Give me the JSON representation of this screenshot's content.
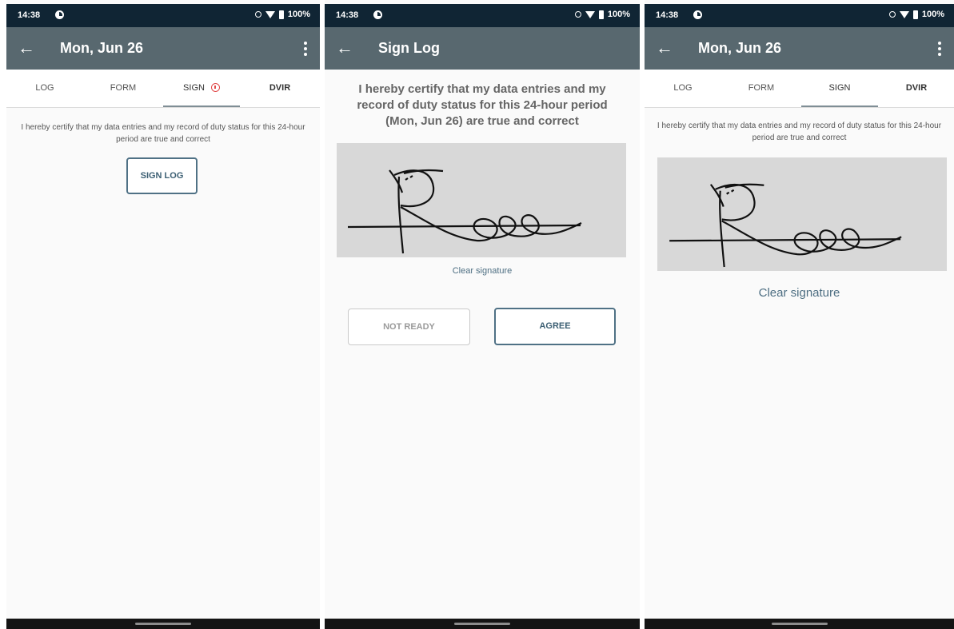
{
  "status_bar": {
    "time": "14:38",
    "battery": "100%"
  },
  "screens": [
    {
      "title": "Mon, Jun 26",
      "tabs": [
        "LOG",
        "FORM",
        "SIGN",
        "DVIR"
      ],
      "certification": "I hereby certify that my data entries and my record of duty status for this 24-hour period are true and correct",
      "sign_button": "SIGN LOG"
    },
    {
      "title": "Sign Log",
      "certification": "I hereby certify that my data entries and my record of duty status for this 24-hour period (Mon, Jun 26) are true and correct",
      "clear_signature": "Clear signature",
      "not_ready_button": "NOT READY",
      "agree_button": "AGREE"
    },
    {
      "title": "Mon, Jun 26",
      "tabs": [
        "LOG",
        "FORM",
        "SIGN",
        "DVIR"
      ],
      "certification": "I hereby certify that my data entries and my record of duty status for this 24-hour period are true and correct",
      "clear_signature": "Clear signature"
    }
  ],
  "icons": {
    "back": "arrow-left-icon",
    "more": "more-vertical-icon",
    "warning": "alert-circle-icon",
    "status": [
      "notification-icon",
      "alarm-icon",
      "wifi-icon",
      "battery-icon"
    ]
  },
  "colors": {
    "status_bar": "#102534",
    "app_bar": "#58686f",
    "accent": "#4f7185",
    "warning": "#e24a4a",
    "signature_pad": "#d8d8d8"
  }
}
